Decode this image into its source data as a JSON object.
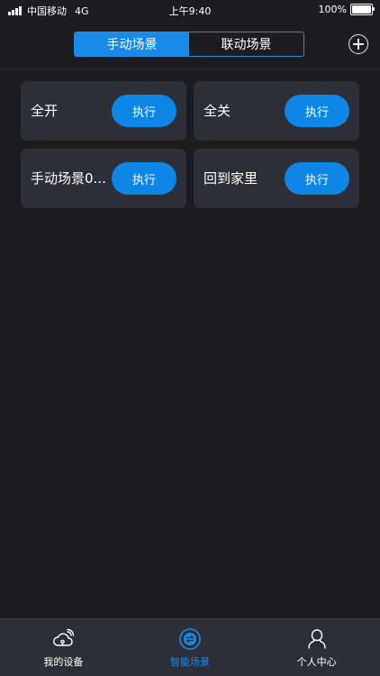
{
  "status_bar": {
    "carrier": "中国移动",
    "network": "4G",
    "time": "上午9:40",
    "battery": "100%",
    "battery_level": 1.0,
    "signal_bars": 4
  },
  "header": {
    "tabs": [
      {
        "label": "手动场景",
        "active": true
      },
      {
        "label": "联动场景",
        "active": false
      }
    ]
  },
  "scenes": [
    {
      "name": "全开",
      "action": "执行"
    },
    {
      "name": "全关",
      "action": "执行"
    },
    {
      "name": "手动场景0...",
      "action": "执行"
    },
    {
      "name": "回到家里",
      "action": "执行"
    }
  ],
  "tabbar": {
    "items": [
      {
        "label": "我的设备",
        "icon": "cloud-device-icon",
        "active": false
      },
      {
        "label": "智能场景",
        "icon": "smart-scene-icon",
        "active": true
      },
      {
        "label": "个人中心",
        "icon": "person-icon",
        "active": false
      }
    ]
  },
  "colors": {
    "accent": "#1a8ae8",
    "background": "#1c1c21",
    "card": "#2d2f38"
  }
}
